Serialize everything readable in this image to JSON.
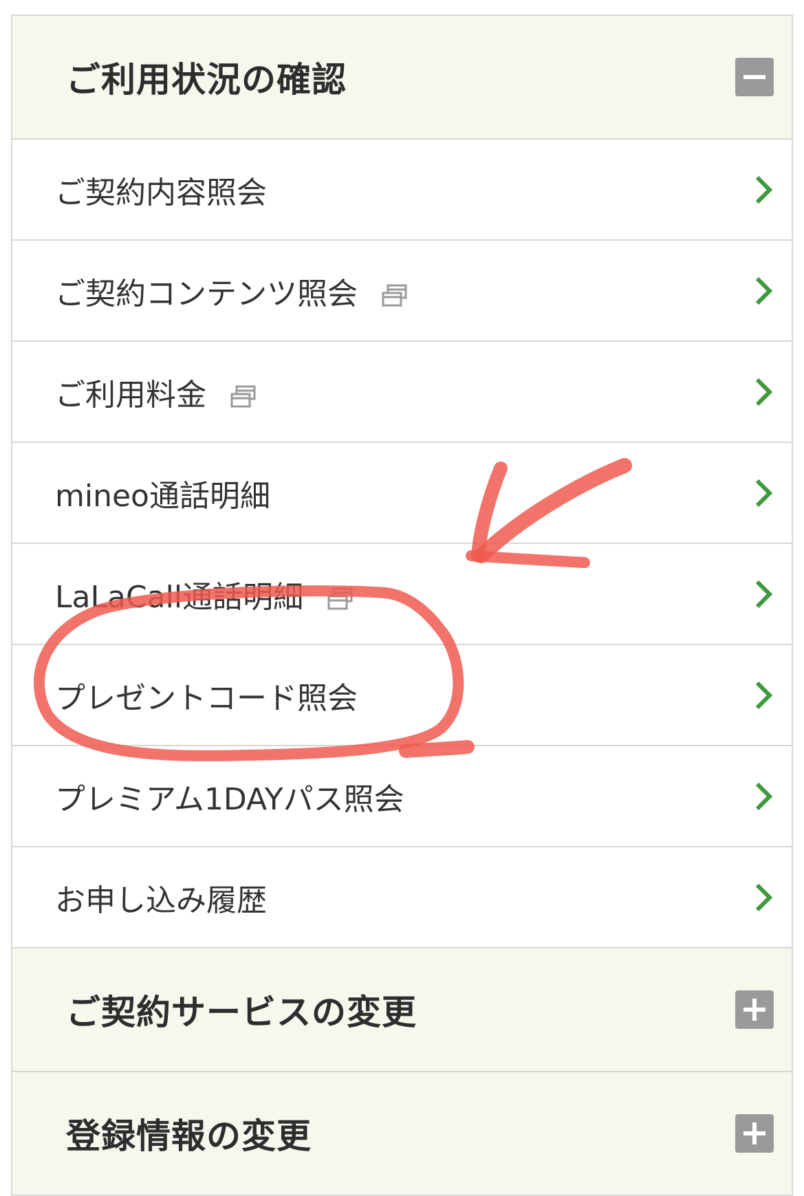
{
  "sections": {
    "usage": {
      "title": "ご利用状況の確認",
      "toggle": "minus-icon"
    },
    "contract_change": {
      "title": "ご契約サービスの変更",
      "toggle": "plus-icon"
    },
    "registration_change": {
      "title": "登録情報の変更",
      "toggle": "plus-icon"
    }
  },
  "menu_items": [
    {
      "label": "ご契約内容照会",
      "external": false
    },
    {
      "label": "ご契約コンテンツ照会",
      "external": true
    },
    {
      "label": "ご利用料金",
      "external": true
    },
    {
      "label": "mineo通話明細",
      "external": false
    },
    {
      "label": "LaLaCall通話明細",
      "external": true
    },
    {
      "label": "プレゼントコード照会",
      "external": false
    },
    {
      "label": "プレミアム1DAYパス照会",
      "external": false
    },
    {
      "label": "お申し込み履歴",
      "external": false
    }
  ],
  "icons": {
    "chevron": "chevron-right-icon",
    "external": "new-window-icon"
  },
  "colors": {
    "header_bg": "#f7f7ee",
    "border": "#d7d7d3",
    "chevron": "#3f9a3f",
    "toggle_bg": "#9a9a9a",
    "annotation": "#ef5a4f"
  }
}
